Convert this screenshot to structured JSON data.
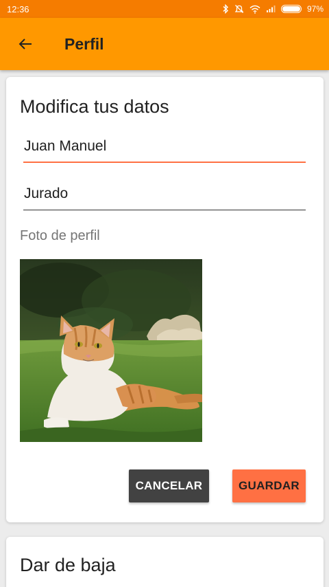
{
  "status_bar": {
    "time": "12:36",
    "battery": "97%"
  },
  "app_bar": {
    "title": "Perfil"
  },
  "edit_card": {
    "title": "Modifica tus datos",
    "first_name": "Juan Manuel",
    "last_name": "Jurado",
    "photo_label": "Foto de perfil",
    "cancel_label": "CANCELAR",
    "save_label": "GUARDAR"
  },
  "delete_card": {
    "title": "Dar de baja"
  },
  "colors": {
    "status_bar": "#f57c00",
    "app_bar": "#ff9800",
    "accent": "#ff7043",
    "cancel_button": "#424242"
  },
  "icons": {
    "back": "arrow-back-icon",
    "bluetooth": "bluetooth-icon",
    "alarm_off": "alarm-off-icon",
    "wifi": "wifi-icon",
    "signal": "signal-icon",
    "battery": "battery-icon"
  }
}
